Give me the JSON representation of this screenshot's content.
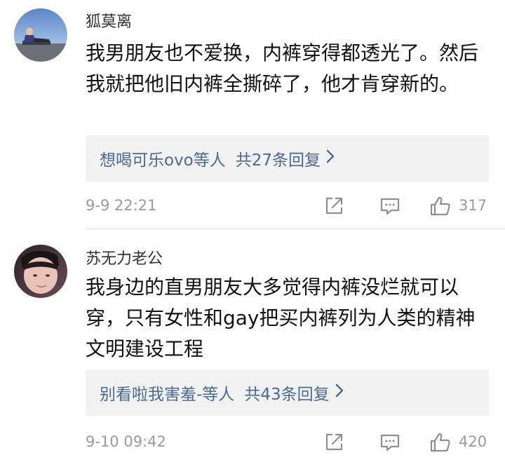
{
  "colors": {
    "name_text": "#333333",
    "body_text": "#111111",
    "link": "#4b6a93",
    "meta_text": "#9b9b9b",
    "reply_bg": "#f2f2f2"
  },
  "comments": [
    {
      "username": "狐莫离",
      "text": "我男朋友也不爱换，内裤穿得都透光了。然后我就把他旧内裤全撕碎了，他才肯穿新的。",
      "replies_users": "想喝可乐ovo等人",
      "replies_count": "共27条回复",
      "timestamp": "9-9 22:21",
      "likes": "317"
    },
    {
      "username": "苏无力老公",
      "text": "我身边的直男朋友大多觉得内裤没烂就可以穿，只有女性和gay把买内裤列为人类的精神文明建设工程",
      "replies_users": "别看啦我害羞-等人",
      "replies_count": "共43条回复",
      "timestamp": "9-10 09:42",
      "likes": "420"
    }
  ],
  "icons": {
    "reply_chevron": "chevron-right-icon",
    "share": "share-icon",
    "reply": "comment-icon",
    "like": "thumbs-up-icon"
  }
}
